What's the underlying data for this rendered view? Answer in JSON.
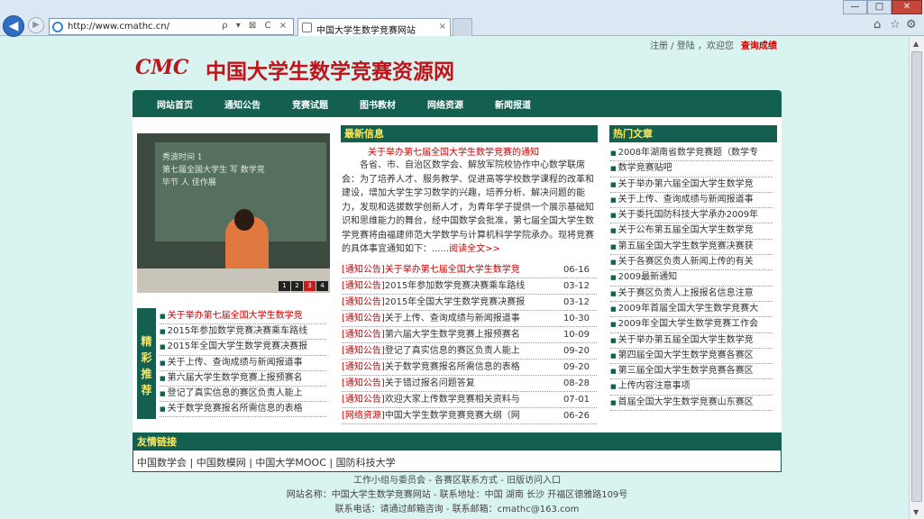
{
  "browser": {
    "url": "http://www.cmathc.cn/",
    "tab_title": "中国大学生数学竞赛网站",
    "addr_tools": "ρ ▾ ⊠ C ×",
    "back": "◀",
    "forward": "▶",
    "win_min": "—",
    "win_max": "□",
    "win_close": "✕",
    "home_icon": "⌂",
    "star_icon": "☆",
    "gear_icon": "⚙",
    "tab_close": "×"
  },
  "top_links": {
    "text": "注册 / 登陆 ，欢迎您",
    "hot": "查询成绩"
  },
  "logo": {
    "mark": "CMC",
    "name": "中国大学生数学竞赛资源网"
  },
  "nav": [
    "网站首页",
    "通知公告",
    "竞赛试题",
    "图书教材",
    "网络资源",
    "新闻报道"
  ],
  "slideshow": {
    "board_text": [
      "秀波时间  1",
      "第七届全国大学生  写  数学竞",
      "毕节  人  佳作展"
    ],
    "pages": [
      "1",
      "2",
      "3",
      "4"
    ],
    "active_page": "3"
  },
  "recommend": {
    "tag": [
      "精",
      "彩",
      "推",
      "荐"
    ],
    "items": [
      "关于举办第七届全国大学生数学竞",
      "2015年参加数学竞赛决赛乘车路线",
      "2015年全国大学生数学竞赛决赛报",
      "关于上传、查询成绩与新闻报道事",
      "第六届大学生数学竞赛上报预赛名",
      "登记了真实信息的赛区负责人能上",
      "关于数学竞赛报名所需信息的表格"
    ]
  },
  "news": {
    "head": "最新信息",
    "title": "关于举办第七届全国大学生数学竞赛的通知",
    "body": "各省、市、自治区数学会、解放军院校协作中心数学联席会：为了培养人才、服务教学、促进高等学校数学课程的改革和建设，增加大学生学习数学的兴趣，培养分析、解决问题的能力，发现和选拔数学创新人才，为青年学子提供一个展示基础知识和思维能力的舞台，经中国数学会批准，第七届全国大学生数学竞赛将由福建师范大学数学与计算机科学学院承办。现将竞赛的具体事宜通知如下：......",
    "more": "阅读全文>>",
    "list": [
      {
        "cat": "[通知公告]",
        "title": "关于举办第七届全国大学生数学竞",
        "date": "06-16"
      },
      {
        "cat": "[通知公告]",
        "title": "2015年参加数学竞赛决赛乘车路线",
        "date": "03-12"
      },
      {
        "cat": "[通知公告]",
        "title": "2015年全国大学生数学竞赛决赛报",
        "date": "03-12"
      },
      {
        "cat": "[通知公告]",
        "title": "关于上传、查询成绩与新闻报道事",
        "date": "10-30"
      },
      {
        "cat": "[通知公告]",
        "title": "第六届大学生数学竞赛上报预赛名",
        "date": "10-09"
      },
      {
        "cat": "[通知公告]",
        "title": "登记了真实信息的赛区负责人能上",
        "date": "09-20"
      },
      {
        "cat": "[通知公告]",
        "title": "关于数学竞赛报名所需信息的表格",
        "date": "09-20"
      },
      {
        "cat": "[通知公告]",
        "title": "关于错过报名问题答复",
        "date": "08-28"
      },
      {
        "cat": "[通知公告]",
        "title": "欢迎大家上传数学竞赛相关资料与",
        "date": "07-01"
      },
      {
        "cat": "[网络资源]",
        "title": "中国大学生数学竞赛竞赛大纲（网",
        "date": "06-26"
      }
    ]
  },
  "hot": {
    "head": "热门文章",
    "items": [
      "2008年湖南省数学竞赛题（数学专",
      "数学竞赛贴吧",
      "关于举办第六届全国大学生数学竞",
      "关于上传、查询成绩与新闻报道事",
      "关于委托国防科技大学承办2009年",
      "关于公布第五届全国大学生数学竞",
      "第五届全国大学生数学竞赛决赛获",
      "关于各赛区负责人新闻上传的有关",
      "2009最新通知",
      "关于赛区负责人上报报名信息注意",
      "2009年首届全国大学生数学竞赛大",
      "2009年全国大学生数学竞赛工作会",
      "关于举办第五届全国大学生数学竞",
      "第四届全国大学生数学竞赛各赛区",
      "第三届全国大学生数学竞赛各赛区",
      "上传内容注意事项",
      "首届全国大学生数学竞赛山东赛区"
    ]
  },
  "friend_links": {
    "head": "友情链接",
    "items": [
      "中国数学会",
      "中国数模网",
      "中国大学MOOC",
      "国防科技大学"
    ]
  },
  "footer": {
    "line1": "工作小组与委员会 - 各赛区联系方式 - 旧版访问入口",
    "line2": "网站名称：中国大学生数学竞赛网站 - 联系地址：中国 湖南 长沙 开福区德雅路109号",
    "line3": "联系电话：请通过邮箱咨询 - 联系邮箱：cmathc@163.com"
  }
}
